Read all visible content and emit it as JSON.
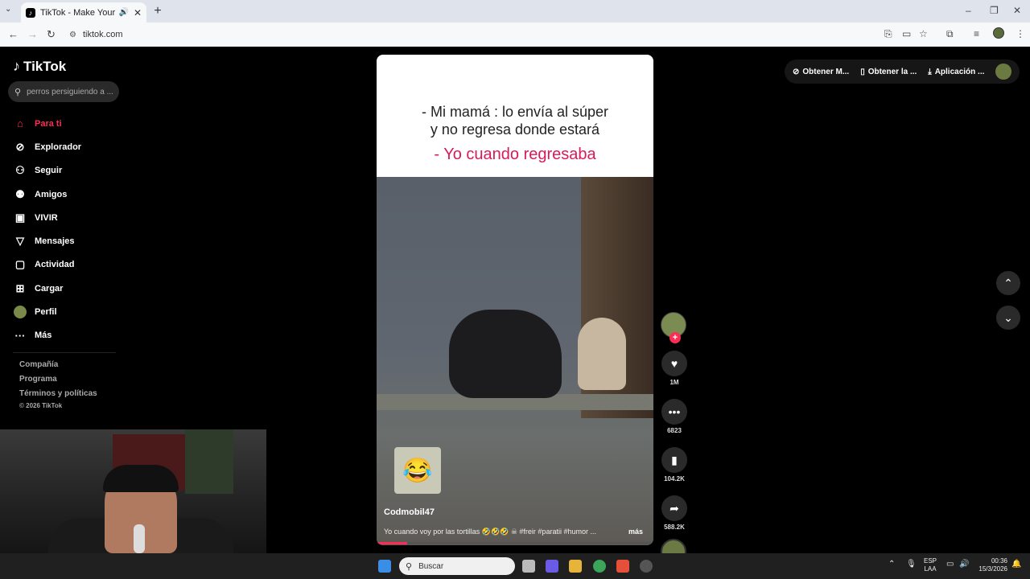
{
  "browser": {
    "tab_title": "TikTok - Make Your Day",
    "tab_favicon": "♪",
    "new_tab": "+",
    "url": "tiktok.com"
  },
  "sidebar": {
    "logo": "TikTok",
    "search_placeholder": "perros persiguiendo a ...",
    "items": [
      {
        "label": "Para ti",
        "icon": "home-icon",
        "glyph": "⌂"
      },
      {
        "label": "Explorador",
        "icon": "compass-icon",
        "glyph": "⊘"
      },
      {
        "label": "Seguir",
        "icon": "follow-icon",
        "glyph": "⚇"
      },
      {
        "label": "Amigos",
        "icon": "friends-icon",
        "glyph": "⚉"
      },
      {
        "label": "VIVIR",
        "icon": "live-icon",
        "glyph": "▣"
      },
      {
        "label": "Mensajes",
        "icon": "messages-icon",
        "glyph": "▽"
      },
      {
        "label": "Actividad",
        "icon": "activity-icon",
        "glyph": "▢"
      },
      {
        "label": "Cargar",
        "icon": "upload-icon",
        "glyph": "⊞"
      },
      {
        "label": "Perfil",
        "icon": "profile-avatar",
        "glyph": ""
      },
      {
        "label": "Más",
        "icon": "more-icon",
        "glyph": "···"
      }
    ],
    "footer": [
      "Compañía",
      "Programa",
      "Términos y políticas"
    ],
    "copyright": "© 2026 TikTok"
  },
  "video": {
    "caption_line1": "- Mi mamá : lo envía al súper",
    "caption_line2": "y no regresa donde estará",
    "caption_line3": "- Yo cuando regresaba",
    "author": "Codmobil47",
    "description": "Yo cuando voy por las tortillas 🤣🤣🤣 ☠ #freir #paratii #humor ...",
    "more": "más",
    "progress": 0.11
  },
  "actions": [
    {
      "name": "like",
      "icon": "heart-icon",
      "glyph": "♥",
      "count": "1M"
    },
    {
      "name": "comment",
      "icon": "comment-icon",
      "glyph": "💬",
      "count": "6823"
    },
    {
      "name": "save",
      "icon": "bookmark-icon",
      "glyph": "🔖",
      "count": "104.2K"
    },
    {
      "name": "share",
      "icon": "share-icon",
      "glyph": "➦",
      "count": "588.2K"
    }
  ],
  "top_buttons": [
    {
      "label": "Obtener M...",
      "icon": "coin-icon",
      "glyph": "⊘"
    },
    {
      "label": "Obtener la ...",
      "icon": "phone-icon",
      "glyph": "▯"
    },
    {
      "label": "Aplicación ...",
      "icon": "download-icon",
      "glyph": "⤓"
    }
  ],
  "taskbar": {
    "search": "Buscar",
    "lang_line1": "ESP",
    "lang_line2": "LAA",
    "time": "00:36",
    "date": "15/3/2026"
  },
  "colors": {
    "accent": "#fe2c55",
    "caption_pink": "#d81a5a"
  }
}
